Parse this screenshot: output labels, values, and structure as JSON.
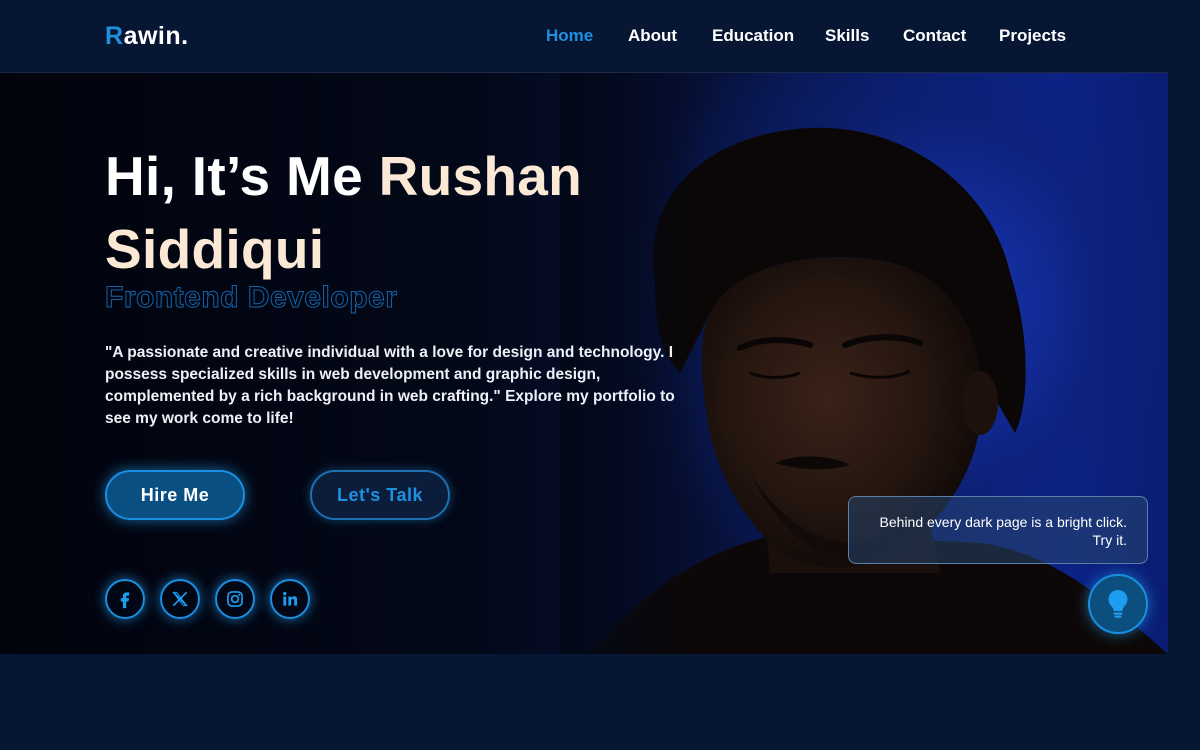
{
  "header": {
    "logo_first": "R",
    "logo_rest": "awin.",
    "nav": [
      {
        "label": "Home",
        "active": true
      },
      {
        "label": "About",
        "active": false
      },
      {
        "label": "Education",
        "active": false
      },
      {
        "label": "Skills",
        "active": false
      },
      {
        "label": "Contact",
        "active": false
      },
      {
        "label": "Projects",
        "active": false
      }
    ]
  },
  "hero": {
    "greeting": "Hi, It’s Me ",
    "name_line1": "Rushan",
    "name_line2": "Siddiqui",
    "role": "Frontend Developer",
    "description": "\"A passionate and creative individual with a love for design and technology. I possess specialized skills in web development and graphic design, complemented by a rich background in web crafting.\" Explore my portfolio to see my work come to life!",
    "hire_button": "Hire Me",
    "talk_button": "Let's Talk",
    "socials": [
      {
        "icon": "facebook-icon"
      },
      {
        "icon": "x-icon"
      },
      {
        "icon": "instagram-icon"
      },
      {
        "icon": "linkedin-icon"
      }
    ],
    "portrait": {
      "icon": "portrait-photo"
    }
  },
  "theme_toggle": {
    "tooltip": "Behind every dark page is a bright click. Try it.",
    "icon": "lightbulb-icon"
  },
  "colors": {
    "accent": "#1e90e0",
    "background": "#061633",
    "name_highlight": "#fbe9d6"
  }
}
